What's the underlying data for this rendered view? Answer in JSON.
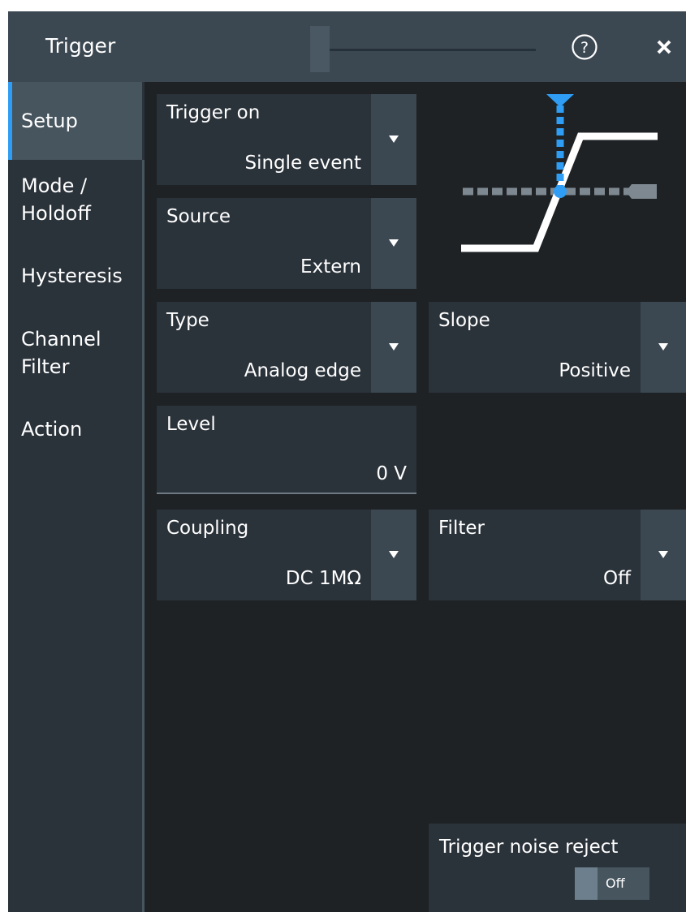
{
  "window": {
    "title": "Trigger",
    "help_icon": "question-circle-icon",
    "close_icon": "close-icon"
  },
  "sidebar": {
    "items": [
      {
        "label": "Setup",
        "active": true
      },
      {
        "label": "Mode /\nHoldoff",
        "active": false
      },
      {
        "label": "Hysteresis",
        "active": false
      },
      {
        "label": "Channel\nFilter",
        "active": false
      },
      {
        "label": "Action",
        "active": false
      }
    ]
  },
  "fields": {
    "trigger_on": {
      "label": "Trigger on",
      "value": "Single event"
    },
    "source": {
      "label": "Source",
      "value": "Extern"
    },
    "type": {
      "label": "Type",
      "value": "Analog edge"
    },
    "slope": {
      "label": "Slope",
      "value": "Positive"
    },
    "level": {
      "label": "Level",
      "value": "0 V"
    },
    "coupling": {
      "label": "Coupling",
      "value": "DC 1MΩ"
    },
    "filter": {
      "label": "Filter",
      "value": "Off"
    }
  },
  "noise_reject": {
    "label": "Trigger noise reject",
    "state": "Off"
  },
  "colors": {
    "accent": "#2f9df4",
    "background": "#1e2225",
    "panel": "#2a323a",
    "titlebar": "#3b4751"
  }
}
